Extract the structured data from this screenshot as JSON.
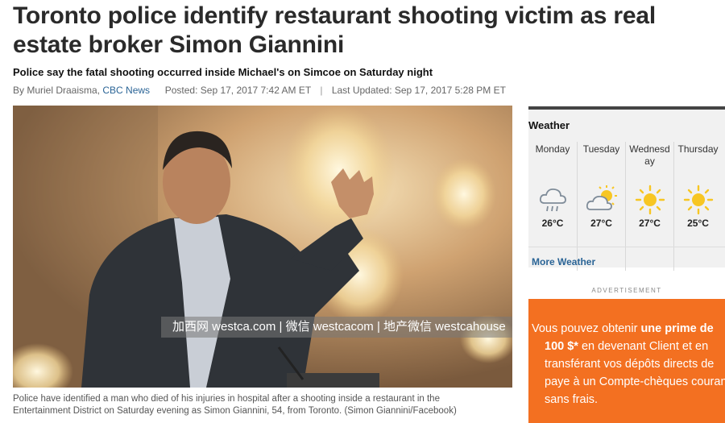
{
  "article": {
    "headline": "Toronto police identify restaurant shooting victim as real estate broker Simon Giannini",
    "subhead": "Police say the fatal shooting occurred inside Michael's on Simcoe on Saturday night",
    "byline": {
      "prefix": "By Muriel Draaisma,",
      "source": "CBC News",
      "posted": "Posted: Sep 17, 2017 7:42 AM ET",
      "separator": "|",
      "updated": "Last Updated: Sep 17, 2017 5:28 PM ET"
    },
    "photo": {
      "watermark": "加西网 westca.com | 微信 westcacom | 地产微信 westcahouse"
    },
    "caption": "Police have identified a man who died of his injuries in hospital after a shooting inside a restaurant in the Entertainment District on Saturday evening as Simon Giannini, 54, from Toronto. (Simon Giannini/Facebook)"
  },
  "weather": {
    "title": "Weather",
    "days": [
      {
        "name": "Monday",
        "icon": "rain-cloud-icon",
        "temp": "26°C"
      },
      {
        "name": "Tuesday",
        "icon": "partly-cloudy-icon",
        "temp": "27°C"
      },
      {
        "name": "Wednesday",
        "icon": "sun-icon",
        "temp": "27°C"
      },
      {
        "name": "Thursday",
        "icon": "sun-icon",
        "temp": "25°C"
      }
    ],
    "more_link": "More Weather"
  },
  "ad": {
    "label": "ADVERTISEMENT",
    "line1_pre": "Vous pouvez obtenir ",
    "line1_bold": "une prime de",
    "line2_bold": "100 $*",
    "line2_post": " en devenant Client et en",
    "line3": "transférant vos dépôts directs de",
    "line4": "paye à un Compte-chèques courant",
    "line5": "sans frais.",
    "color": "#f37021"
  }
}
